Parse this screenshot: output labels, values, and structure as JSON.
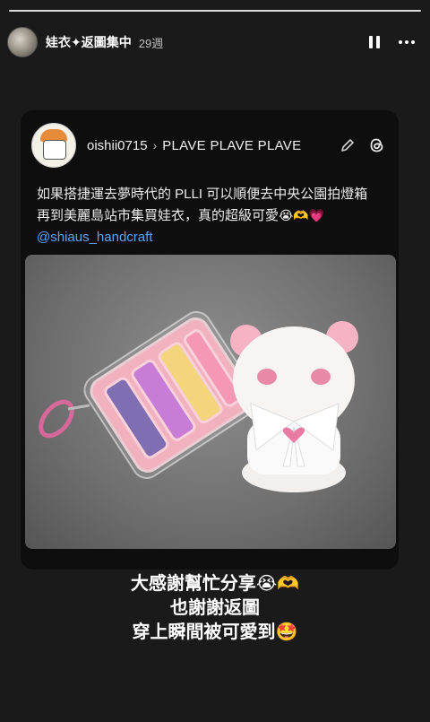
{
  "story": {
    "username": "娃衣✦返圖集中",
    "time": "29週"
  },
  "icons": {
    "pause": "pause-icon",
    "more": "more-horizontal-icon",
    "edit": "pencil-icon",
    "threads": "threads-logo-icon",
    "chevron": "chevron-right-icon"
  },
  "card": {
    "username": "oishii0715",
    "channel": "PLAVE PLAVE PLAVE",
    "text_line1": "如果搭捷運去夢時代的 PLLI 可以順便去中央公園拍燈箱",
    "text_line2_prefix": "再到美麗島站市集買娃衣，真的超級可愛",
    "text_line2_emoji": "😭🫶💗",
    "mention": "@shiaus_handcraft"
  },
  "caption": {
    "line1": "大感謝幫忙分享😭🫶",
    "line2": "也謝謝返圖",
    "line3": "穿上瞬間被可愛到🤩"
  },
  "colors": {
    "background": "#1a1a1a",
    "card": "#0e0e0e",
    "mention": "#5aa6ff"
  }
}
